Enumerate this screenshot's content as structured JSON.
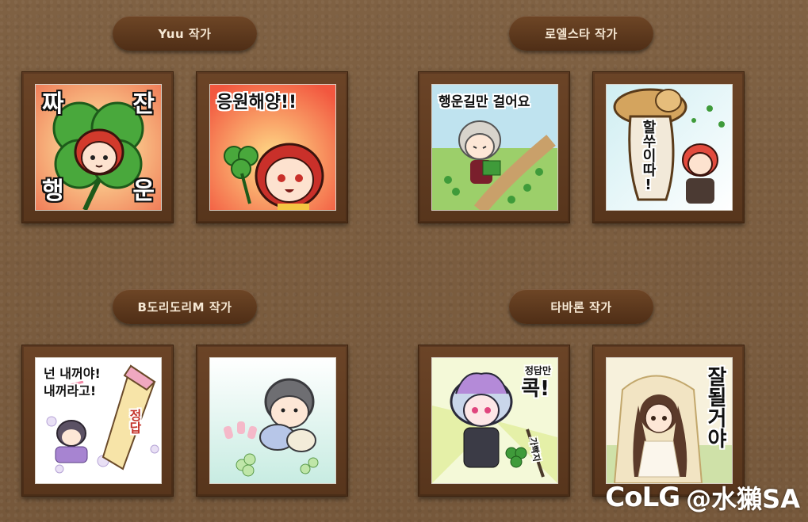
{
  "groups": [
    {
      "label": "Yuu 작가"
    },
    {
      "label": "로엘스타 작가"
    },
    {
      "label": "B도리도리M 작가"
    },
    {
      "label": "타바론 작가"
    }
  ],
  "stickers": {
    "s1": {
      "tl": "짜",
      "tr": "잔",
      "bl": "행",
      "br": "운"
    },
    "s2": {
      "text": "응원해양!!"
    },
    "s3": {
      "text": "행운길만 걸어요"
    },
    "s4": {
      "text": "할쑤이따!"
    },
    "s5": {
      "line1": "넌 내꺼야!",
      "line2": "내꺼라고!",
      "tag": "정답"
    },
    "s7": {
      "text": "정답만",
      "big": "콕!",
      "tag": "가빡지"
    },
    "s8": {
      "text": "잘될거야"
    }
  },
  "watermark": {
    "logo": "CoLG",
    "handle": "@水獺SA"
  },
  "colors": {
    "background": "#7d5f41",
    "pill": "#5a3519",
    "pill_text": "#f6e8d4"
  }
}
